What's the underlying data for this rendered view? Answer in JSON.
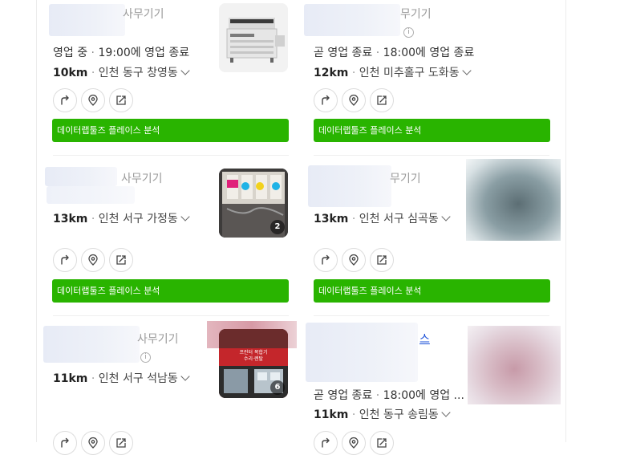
{
  "colors": {
    "green": "#29b400",
    "link": "#1a4fd8"
  },
  "action_icons": [
    "route-arrow-icon",
    "location-pin-icon",
    "share-icon"
  ],
  "cards": [
    {
      "category": "사무기기",
      "status_prefix": "영업 중",
      "status_rest": "19:00에 영업 종료",
      "distance": "10km",
      "address": "인천 동구 창영동",
      "analysis_label": "데이터랩툴즈 플레이스 분석"
    },
    {
      "category": "무기기",
      "status_prefix": "곧 영업 종료",
      "status_rest": "18:00에 영업 종료",
      "distance": "12km",
      "address": "인천 미추홀구 도화동",
      "analysis_label": "데이터랩툴즈 플레이스 분석"
    },
    {
      "category": "사무기기",
      "distance": "13km",
      "address": "인천 서구 가정동",
      "analysis_label": "데이터랩툴즈 플레이스 분석",
      "photo_count": "2"
    },
    {
      "category": "무기기",
      "distance": "13km",
      "address": "인천 서구 심곡동",
      "analysis_label": "데이터랩툴즈 플레이스 분석"
    },
    {
      "category": "사무기기",
      "distance": "11km",
      "address": "인천 서구 석남동",
      "photo_count": "6",
      "sign_line1": "프린터 복합기",
      "sign_line2": "수리·렌탈"
    },
    {
      "category_fragment": "스",
      "status_prefix": "곧 영업 종료",
      "status_rest": "18:00에 영업 ...",
      "distance": "11km",
      "address": "인천 동구 송림동"
    }
  ]
}
